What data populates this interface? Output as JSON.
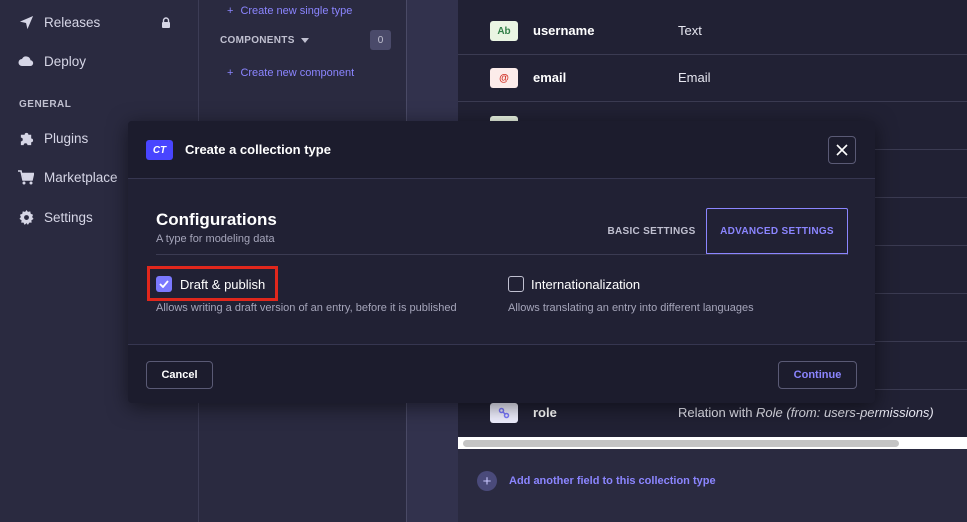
{
  "nav": {
    "items": [
      {
        "label": "Releases",
        "icon": "paper-plane-icon"
      },
      {
        "label": "Deploy",
        "icon": "cloud-icon"
      },
      {
        "label": "Plugins",
        "icon": "puzzle-icon"
      },
      {
        "label": "Marketplace",
        "icon": "cart-icon"
      },
      {
        "label": "Settings",
        "icon": "gear-icon"
      }
    ],
    "section_general": "GENERAL"
  },
  "subnav": {
    "create_single_type": "Create new single type",
    "components_heading": "COMPONENTS",
    "components_count": "0",
    "create_component": "Create new component"
  },
  "fields": [
    {
      "icon_text": "Ab",
      "name": "username",
      "type": "Text"
    },
    {
      "icon_text": "@",
      "name": "email",
      "type": "Email"
    },
    {
      "icon_text": "",
      "name": "",
      "type": ""
    },
    {
      "icon_text": "",
      "name": "role",
      "type": "Relation with ",
      "type_italic": "Role (from: users-permissions)"
    }
  ],
  "add_field_label": "Add another field to this collection type",
  "modal": {
    "badge": "CT",
    "title": "Create a collection type",
    "config_title": "Configurations",
    "config_subtitle": "A type for modeling data",
    "tabs": {
      "basic": "BASIC SETTINGS",
      "advanced": "ADVANCED SETTINGS"
    },
    "options": [
      {
        "label": "Draft & publish",
        "hint": "Allows writing a draft version of an entry, before it is published",
        "checked": true
      },
      {
        "label": "Internationalization",
        "hint": "Allows translating an entry into different languages",
        "checked": false
      }
    ],
    "cancel_label": "Cancel",
    "continue_label": "Continue"
  },
  "colors": {
    "accent": "#8b85ff",
    "primary": "#4945ff",
    "highlight": "#e0271c"
  }
}
